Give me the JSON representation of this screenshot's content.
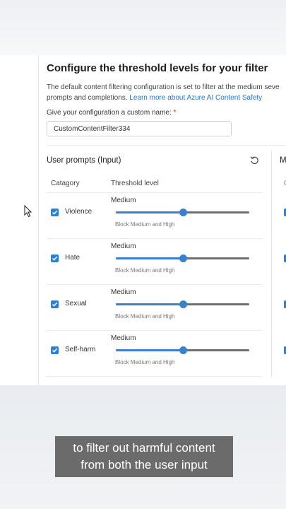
{
  "panel": {
    "title": "Configure the threshold levels for your filter",
    "description_line1": "The default content filtering configuration is set to filter at the medium seve",
    "description_line2_prefix": "prompts and completions. ",
    "description_link": "Learn more about Azure AI Content Safety",
    "name_label": "Give your configuration a custom name:",
    "name_required_marker": "*",
    "name_value": "CustomContentFilter334"
  },
  "user_prompts": {
    "section_title": "User prompts (Input)",
    "reset_icon": "undo-icon",
    "next_section_initial": "M",
    "next_section_column_initial": "C",
    "column_category": "Catagory",
    "column_threshold": "Threshold level",
    "rows": [
      {
        "category": "Violence",
        "checked": true,
        "level": "Medium",
        "level_fraction": 0.5,
        "hint": "Block Medium and High"
      },
      {
        "category": "Hate",
        "checked": true,
        "level": "Medium",
        "level_fraction": 0.5,
        "hint": "Block Medium and High"
      },
      {
        "category": "Sexual",
        "checked": true,
        "level": "Medium",
        "level_fraction": 0.5,
        "hint": "Block Medium and High"
      },
      {
        "category": "Self-harm",
        "checked": true,
        "level": "Medium",
        "level_fraction": 0.5,
        "hint": "Block Medium and High"
      }
    ]
  },
  "caption": {
    "line1": "to filter out harmful content",
    "line2": "from both the user input"
  },
  "colors": {
    "accent": "#3b80cc",
    "checkbox": "#2f80d1",
    "track": "#6f6f6f",
    "link": "#2a74c5"
  }
}
